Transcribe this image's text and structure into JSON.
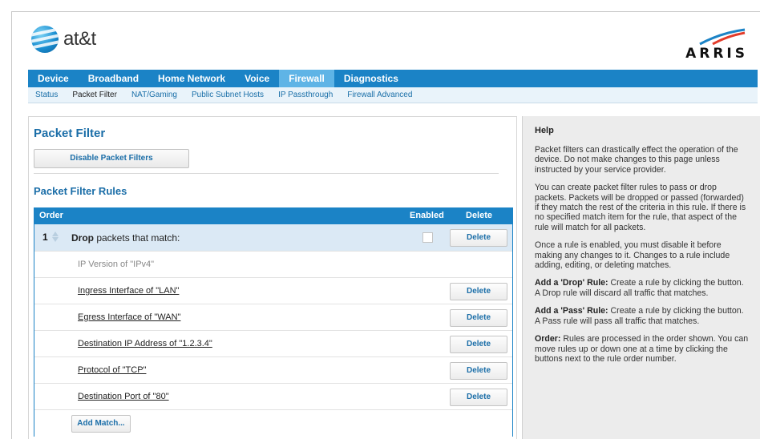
{
  "brand": {
    "att": "at&t",
    "arris": "ARRIS",
    "accent": "#1b83c6"
  },
  "nav": {
    "items": [
      "Device",
      "Broadband",
      "Home Network",
      "Voice",
      "Firewall",
      "Diagnostics"
    ],
    "active": "Firewall"
  },
  "subnav": {
    "items": [
      "Status",
      "Packet Filter",
      "NAT/Gaming",
      "Public Subnet Hosts",
      "IP Passthrough",
      "Firewall Advanced"
    ],
    "active": "Packet Filter"
  },
  "main": {
    "title": "Packet Filter",
    "disable_button": "Disable Packet Filters",
    "rules_title": "Packet Filter Rules",
    "columns": {
      "order": "Order",
      "enabled": "Enabled",
      "delete": "Delete"
    },
    "rule": {
      "number": "1",
      "action": "Drop",
      "action_suffix": " packets that match:",
      "enabled": false,
      "delete_label": "Delete"
    },
    "matches": [
      {
        "label": "IP Version of \"IPv4\"",
        "deletable": false
      },
      {
        "label": "Ingress Interface of \"LAN\"",
        "deletable": true
      },
      {
        "label": "Egress Interface of \"WAN\"",
        "deletable": true
      },
      {
        "label": "Destination IP Address of \"1.2.3.4\"",
        "deletable": true
      },
      {
        "label": "Protocol of \"TCP\"",
        "deletable": true
      },
      {
        "label": "Destination Port of \"80\"",
        "deletable": true
      }
    ],
    "delete_label": "Delete",
    "add_match": "Add Match..."
  },
  "help": {
    "title": "Help",
    "p1": "Packet filters can drastically effect the operation of the device. Do not make changes to this page unless instructed by your service provider.",
    "p2": "You can create packet filter rules to pass or drop packets. Packets will be dropped or passed (forwarded) if they match the rest of the criteria in this rule. If there is no specified match item for the rule, that aspect of the rule will match for all packets.",
    "p3": "Once a rule is enabled, you must disable it before making any changes to it. Changes to a rule include adding, editing, or deleting matches.",
    "p4_label": "Add a 'Drop' Rule:",
    "p4_text": " Create a rule by clicking the button. A Drop rule will discard all traffic that matches.",
    "p5_label": "Add a 'Pass' Rule:",
    "p5_text": " Create a rule by clicking the button. A Pass rule will pass all traffic that matches.",
    "p6_label": "Order:",
    "p6_text": " Rules are processed in the order shown. You can move rules up or down one at a time by clicking the buttons next to the rule order number."
  }
}
